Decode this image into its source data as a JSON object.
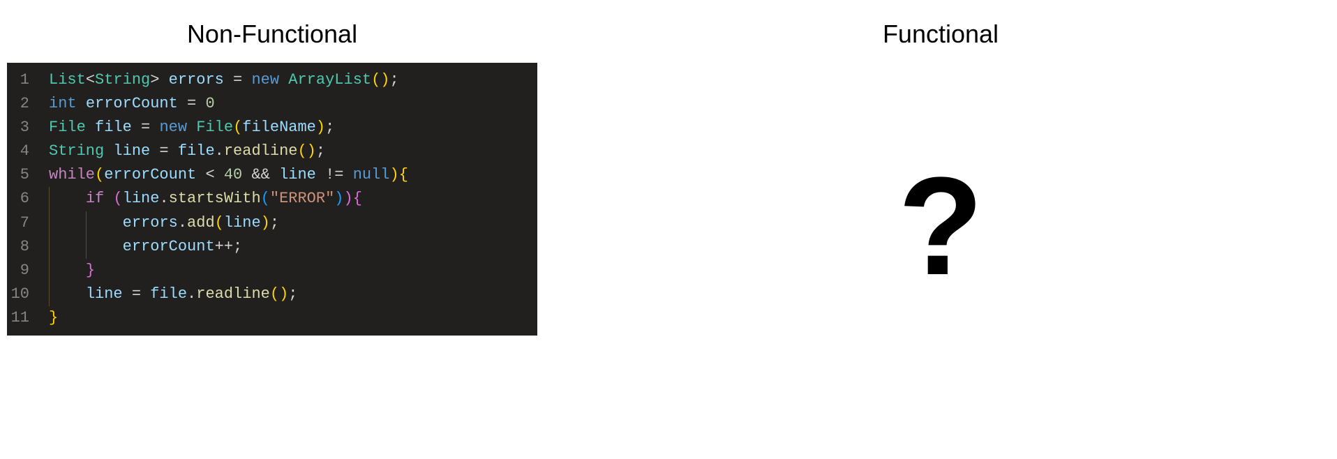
{
  "left": {
    "title": "Non-Functional",
    "code": {
      "lines": [
        {
          "num": "1",
          "tokens": [
            {
              "cls": "t-type",
              "text": "List"
            },
            {
              "cls": "t-punc",
              "text": "<"
            },
            {
              "cls": "t-generic",
              "text": "String"
            },
            {
              "cls": "t-punc",
              "text": ">"
            },
            {
              "cls": "t-op",
              "text": " "
            },
            {
              "cls": "t-var",
              "text": "errors"
            },
            {
              "cls": "t-op",
              "text": " = "
            },
            {
              "cls": "t-new",
              "text": "new"
            },
            {
              "cls": "t-op",
              "text": " "
            },
            {
              "cls": "t-type",
              "text": "ArrayList"
            },
            {
              "cls": "t-bracket1",
              "text": "()"
            },
            {
              "cls": "t-punc",
              "text": ";"
            }
          ],
          "indent": 0
        },
        {
          "num": "2",
          "tokens": [
            {
              "cls": "t-keyword",
              "text": "int"
            },
            {
              "cls": "t-op",
              "text": " "
            },
            {
              "cls": "t-var",
              "text": "errorCount"
            },
            {
              "cls": "t-op",
              "text": " = "
            },
            {
              "cls": "t-num",
              "text": "0"
            }
          ],
          "indent": 0
        },
        {
          "num": "3",
          "tokens": [
            {
              "cls": "t-type",
              "text": "File"
            },
            {
              "cls": "t-op",
              "text": " "
            },
            {
              "cls": "t-var",
              "text": "file"
            },
            {
              "cls": "t-op",
              "text": " = "
            },
            {
              "cls": "t-new",
              "text": "new"
            },
            {
              "cls": "t-op",
              "text": " "
            },
            {
              "cls": "t-type",
              "text": "File"
            },
            {
              "cls": "t-bracket1",
              "text": "("
            },
            {
              "cls": "t-var",
              "text": "fileName"
            },
            {
              "cls": "t-bracket1",
              "text": ")"
            },
            {
              "cls": "t-punc",
              "text": ";"
            }
          ],
          "indent": 0
        },
        {
          "num": "4",
          "tokens": [
            {
              "cls": "t-type",
              "text": "String"
            },
            {
              "cls": "t-op",
              "text": " "
            },
            {
              "cls": "t-var",
              "text": "line"
            },
            {
              "cls": "t-op",
              "text": " = "
            },
            {
              "cls": "t-var",
              "text": "file"
            },
            {
              "cls": "t-punc",
              "text": "."
            },
            {
              "cls": "t-func",
              "text": "readline"
            },
            {
              "cls": "t-bracket1",
              "text": "()"
            },
            {
              "cls": "t-punc",
              "text": ";"
            }
          ],
          "indent": 0
        },
        {
          "num": "5",
          "tokens": [
            {
              "cls": "t-keyword2",
              "text": "while"
            },
            {
              "cls": "t-bracket1",
              "text": "("
            },
            {
              "cls": "t-var",
              "text": "errorCount"
            },
            {
              "cls": "t-op",
              "text": " < "
            },
            {
              "cls": "t-num",
              "text": "40"
            },
            {
              "cls": "t-op",
              "text": " && "
            },
            {
              "cls": "t-var",
              "text": "line"
            },
            {
              "cls": "t-op",
              "text": " != "
            },
            {
              "cls": "t-null",
              "text": "null"
            },
            {
              "cls": "t-bracket1",
              "text": ")"
            },
            {
              "cls": "t-bracket1",
              "text": "{"
            }
          ],
          "indent": 0
        },
        {
          "num": "6",
          "tokens": [
            {
              "cls": "t-op",
              "text": "    "
            },
            {
              "cls": "t-keyword2",
              "text": "if"
            },
            {
              "cls": "t-op",
              "text": " "
            },
            {
              "cls": "t-bracket2",
              "text": "("
            },
            {
              "cls": "t-var",
              "text": "line"
            },
            {
              "cls": "t-punc",
              "text": "."
            },
            {
              "cls": "t-func",
              "text": "startsWith"
            },
            {
              "cls": "t-bracket3",
              "text": "("
            },
            {
              "cls": "t-str",
              "text": "\"ERROR\""
            },
            {
              "cls": "t-bracket3",
              "text": ")"
            },
            {
              "cls": "t-bracket2",
              "text": ")"
            },
            {
              "cls": "t-bracket2",
              "text": "{"
            }
          ],
          "indent": 1,
          "guides": [
            0
          ]
        },
        {
          "num": "7",
          "tokens": [
            {
              "cls": "t-op",
              "text": "        "
            },
            {
              "cls": "t-var",
              "text": "errors"
            },
            {
              "cls": "t-punc",
              "text": "."
            },
            {
              "cls": "t-func",
              "text": "add"
            },
            {
              "cls": "t-bracket1",
              "text": "("
            },
            {
              "cls": "t-var",
              "text": "line"
            },
            {
              "cls": "t-bracket1",
              "text": ")"
            },
            {
              "cls": "t-punc",
              "text": ";"
            }
          ],
          "indent": 2,
          "guides": [
            0,
            1
          ]
        },
        {
          "num": "8",
          "tokens": [
            {
              "cls": "t-op",
              "text": "        "
            },
            {
              "cls": "t-var",
              "text": "errorCount"
            },
            {
              "cls": "t-op",
              "text": "++;"
            }
          ],
          "indent": 2,
          "guides": [
            0,
            1
          ]
        },
        {
          "num": "9",
          "tokens": [
            {
              "cls": "t-op",
              "text": "    "
            },
            {
              "cls": "t-bracket2",
              "text": "}"
            }
          ],
          "indent": 1,
          "guides": [
            0
          ]
        },
        {
          "num": "10",
          "tokens": [
            {
              "cls": "t-op",
              "text": "    "
            },
            {
              "cls": "t-var",
              "text": "line"
            },
            {
              "cls": "t-op",
              "text": " = "
            },
            {
              "cls": "t-var",
              "text": "file"
            },
            {
              "cls": "t-punc",
              "text": "."
            },
            {
              "cls": "t-func",
              "text": "readline"
            },
            {
              "cls": "t-bracket1",
              "text": "()"
            },
            {
              "cls": "t-punc",
              "text": ";"
            }
          ],
          "indent": 1,
          "guides": [
            0
          ]
        },
        {
          "num": "11",
          "tokens": [
            {
              "cls": "t-bracket1",
              "text": "}"
            }
          ],
          "indent": 0
        }
      ]
    }
  },
  "right": {
    "title": "Functional",
    "placeholder": "?"
  }
}
